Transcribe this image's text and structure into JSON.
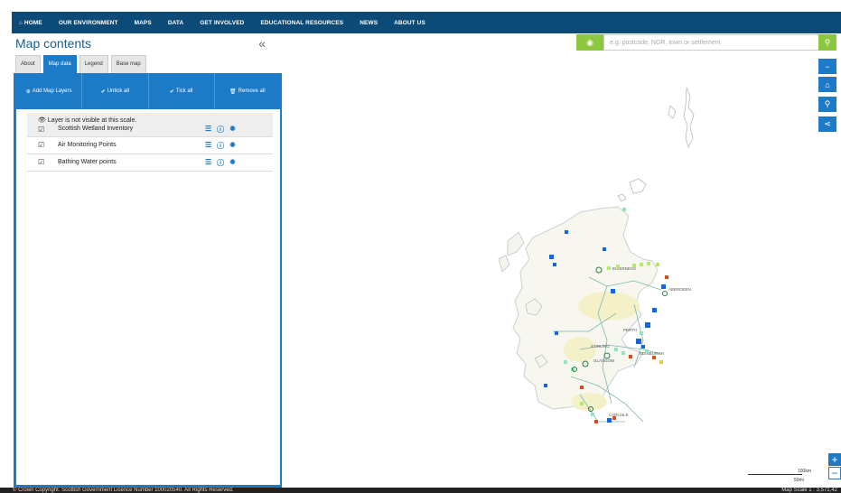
{
  "nav": {
    "items": [
      "⌂ HOME",
      "OUR ENVIRONMENT",
      "MAPS",
      "DATA",
      "GET INVOLVED",
      "EDUCATIONAL RESOURCES",
      "NEWS",
      "ABOUT US"
    ]
  },
  "panel": {
    "title": "Map contents",
    "collapse": "«",
    "tabs": [
      "About",
      "Map data",
      "Legend",
      "Base map"
    ],
    "active_tab": "Map data",
    "toolbar": {
      "add": "Add Map Layers",
      "untick": "Untick all",
      "tick": "Tick all",
      "remove": "Remove all"
    },
    "layers": [
      {
        "note": "Layer is not visible at this scale.",
        "label": "Scottish Wetland Inventory",
        "checked": true,
        "disabled": true
      },
      {
        "label": "Air Monitoring Points",
        "checked": true,
        "disabled": false
      },
      {
        "label": "Bathing Water points",
        "checked": true,
        "disabled": false
      }
    ]
  },
  "search": {
    "placeholder": "e.g. postcode, NGR, town or settlement"
  },
  "map": {
    "places": [
      "INVERNESS",
      "ABERDEEN",
      "PERTH",
      "STIRLING",
      "EDINBURGH",
      "GLASGOW",
      "CARLISLE"
    ],
    "scale_km": "100km",
    "scale_mi": "50mi",
    "colors": {
      "accent": "#1c7ac6",
      "green": "#8dc63f",
      "nav": "#0c4b77"
    }
  },
  "footer": {
    "copyright": "© Crown Copyright. Scottish Government Licence Number 100020540. All Rights Reserved.",
    "scale": "Map Scale 1 : 3,571,42"
  }
}
